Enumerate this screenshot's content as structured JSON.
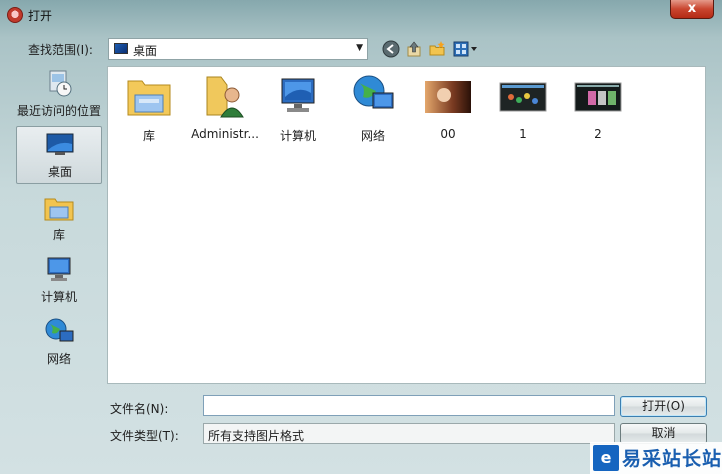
{
  "window": {
    "title": "打开",
    "close_glyph": "x"
  },
  "toolbar": {
    "look_in_label": "查找范围(I):",
    "look_in_value": "桌面",
    "icons": [
      "back-icon",
      "up-folder-icon",
      "new-folder-icon",
      "views-menu-icon"
    ]
  },
  "places": [
    {
      "label": "最近访问的位置",
      "icon": "recent-places-icon"
    },
    {
      "label": "桌面",
      "icon": "desktop-icon",
      "selected": true
    },
    {
      "label": "库",
      "icon": "libraries-icon"
    },
    {
      "label": "计算机",
      "icon": "computer-icon"
    },
    {
      "label": "网络",
      "icon": "network-icon"
    }
  ],
  "files": [
    {
      "label": "库",
      "icon": "libraries-folder-icon"
    },
    {
      "label": "Administr...",
      "icon": "user-folder-icon"
    },
    {
      "label": "计算机",
      "icon": "computer-icon"
    },
    {
      "label": "网络",
      "icon": "network-icon"
    },
    {
      "label": "00",
      "icon": "image-thumbnail"
    },
    {
      "label": "1",
      "icon": "image-thumbnail"
    },
    {
      "label": "2",
      "icon": "image-thumbnail"
    }
  ],
  "form": {
    "file_name_label": "文件名(N):",
    "file_name_value": "",
    "file_type_label": "文件类型(T):",
    "file_type_value": "所有支持图片格式",
    "open_button": "打开(O)",
    "cancel_button": "取消"
  },
  "watermark": {
    "text": "易采站长站"
  },
  "colors": {
    "accent": "#3c7fb1",
    "close": "#c9452f"
  }
}
